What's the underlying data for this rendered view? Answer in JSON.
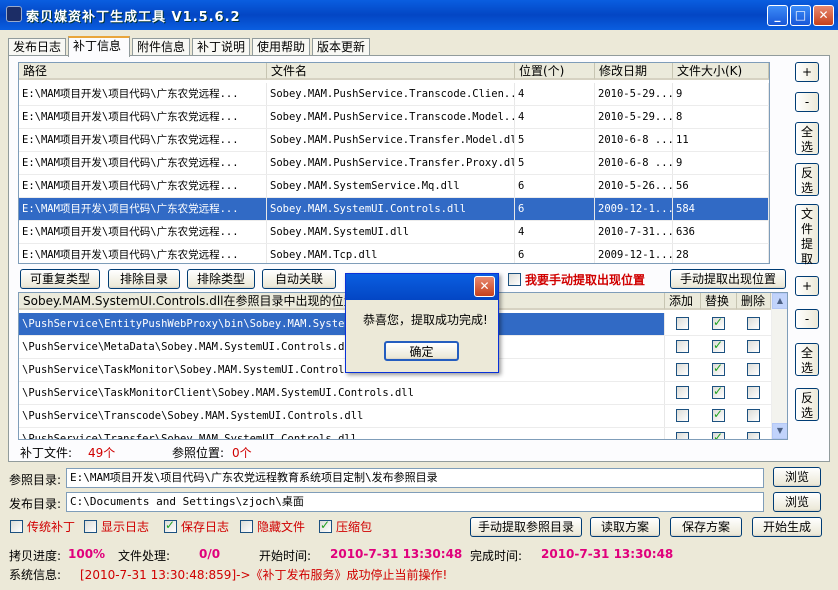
{
  "window": {
    "title": "索贝媒资补丁生成工具 V1.5.6.2",
    "minimize": "_",
    "maximize": "□",
    "close": "✕"
  },
  "tabs": [
    {
      "label": "发布日志"
    },
    {
      "label": "补丁信息"
    },
    {
      "label": "附件信息"
    },
    {
      "label": "补丁说明"
    },
    {
      "label": "使用帮助"
    },
    {
      "label": "版本更新"
    }
  ],
  "files_table": {
    "headers": [
      "路径",
      "文件名",
      "位置(个)",
      "修改日期",
      "文件大小(K)"
    ],
    "rows": [
      [
        "E:\\MAM项目开发\\项目代码\\广东农党远程...",
        "Sobey.MAM.PushService.Transcode.Clien...",
        "4",
        "2010-5-29...",
        "9"
      ],
      [
        "E:\\MAM项目开发\\项目代码\\广东农党远程...",
        "Sobey.MAM.PushService.Transcode.Model...",
        "4",
        "2010-5-29...",
        "8"
      ],
      [
        "E:\\MAM项目开发\\项目代码\\广东农党远程...",
        "Sobey.MAM.PushService.Transfer.Model.dll",
        "5",
        "2010-6-8 ...",
        "11"
      ],
      [
        "E:\\MAM项目开发\\项目代码\\广东农党远程...",
        "Sobey.MAM.PushService.Transfer.Proxy.dll",
        "5",
        "2010-6-8 ...",
        "9"
      ],
      [
        "E:\\MAM项目开发\\项目代码\\广东农党远程...",
        "Sobey.MAM.SystemService.Mq.dll",
        "6",
        "2010-5-26...",
        "56"
      ],
      [
        "E:\\MAM项目开发\\项目代码\\广东农党远程...",
        "Sobey.MAM.SystemUI.Controls.dll",
        "6",
        "2009-12-1...",
        "584"
      ],
      [
        "E:\\MAM项目开发\\项目代码\\广东农党远程...",
        "Sobey.MAM.SystemUI.dll",
        "4",
        "2010-7-31...",
        "636"
      ],
      [
        "E:\\MAM项目开发\\项目代码\\广东农党远程...",
        "Sobey.MAM.Tcp.dll",
        "6",
        "2009-12-1...",
        "28"
      ]
    ],
    "selected_row": 5
  },
  "side_buttons_top": {
    "add": "+",
    "remove": "-",
    "select_all": "全选",
    "invert": "反选",
    "extract": "文件提取"
  },
  "mid_buttons": {
    "dedupe_types": "可重复类型",
    "exclude_dir": "排除目录",
    "exclude_type": "排除类型",
    "auto_link": "自动关联",
    "manual_extract_label": "我要手动提取出现位置",
    "manual_extract_button": "手动提取出现位置"
  },
  "locations_table": {
    "headers": [
      "Sobey.MAM.SystemUI.Controls.dll在参照目录中出现的位置",
      "添加",
      "替换",
      "删除"
    ],
    "rows": [
      {
        "path": "\\PushService\\EntityPushWebProxy\\bin\\Sobey.MAM.SystemUI",
        "add": false,
        "replace": true,
        "del": false
      },
      {
        "path": "\\PushService\\MetaData\\Sobey.MAM.SystemUI.Controls.dll",
        "add": false,
        "replace": true,
        "del": false
      },
      {
        "path": "\\PushService\\TaskMonitor\\Sobey.MAM.SystemUI.Controls.dll",
        "add": false,
        "replace": true,
        "del": false
      },
      {
        "path": "\\PushService\\TaskMonitorClient\\Sobey.MAM.SystemUI.Controls.dll",
        "add": false,
        "replace": true,
        "del": false
      },
      {
        "path": "\\PushService\\Transcode\\Sobey.MAM.SystemUI.Controls.dll",
        "add": false,
        "replace": true,
        "del": false
      },
      {
        "path": "\\PushService\\Transfer\\Sobey.MAM.SystemUI.Controls.dll",
        "add": false,
        "replace": true,
        "del": false
      }
    ],
    "selected_row": 0
  },
  "side_buttons_bottom": {
    "add": "+",
    "remove": "-",
    "select_all": "全选",
    "invert": "反选"
  },
  "counts": {
    "patch_files_label": "补丁文件:",
    "patch_files_value": "49个",
    "ref_locations_label": "参照位置:",
    "ref_locations_value": "0个"
  },
  "paths": {
    "ref_dir_label": "参照目录:",
    "ref_dir_value": "E:\\MAM项目开发\\项目代码\\广东农党远程教育系统项目定制\\发布参照目录",
    "pub_dir_label": "发布目录:",
    "pub_dir_value": "C:\\Documents and Settings\\zjoch\\桌面",
    "browse": "浏览"
  },
  "options": [
    {
      "label": "传统补丁",
      "checked": false
    },
    {
      "label": "显示日志",
      "checked": false
    },
    {
      "label": "保存日志",
      "checked": true
    },
    {
      "label": "隐藏文件",
      "checked": false
    },
    {
      "label": "压缩包",
      "checked": true
    }
  ],
  "action_buttons": {
    "manual_ref": "手动提取参照目录",
    "load_plan": "读取方案",
    "save_plan": "保存方案",
    "generate": "开始生成"
  },
  "status": {
    "progress_label": "拷贝进度:",
    "progress_value": "100%",
    "file_label": "文件处理:",
    "file_value": "0/0",
    "start_label": "开始时间:",
    "start_value": "2010-7-31 13:30:48",
    "end_label": "完成时间:",
    "end_value": "2010-7-31 13:30:48",
    "sys_label": "系统信息:",
    "sys_value": "[2010-7-31 13:30:48:859]->《补丁发布服务》成功停止当前操作!"
  },
  "dialog": {
    "message": "恭喜您，提取成功完成!",
    "ok": "确定",
    "close": "✕"
  }
}
